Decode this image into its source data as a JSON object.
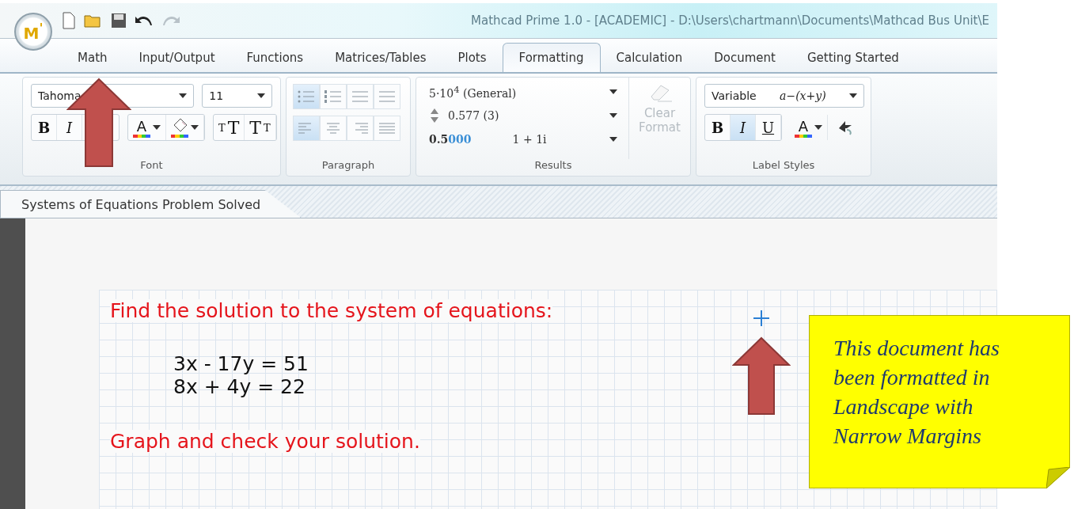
{
  "title_bar": {
    "logo": "M$^{'}$",
    "title": "Mathcad Prime 1.0 - [ACADEMIC] - D:\\Users\\chartmann\\Documents\\Mathcad Bus Unit\\E"
  },
  "ribbon_tabs": [
    {
      "label": "Math",
      "selected": false
    },
    {
      "label": "Input/Output",
      "selected": false
    },
    {
      "label": "Functions",
      "selected": false
    },
    {
      "label": "Matrices/Tables",
      "selected": false
    },
    {
      "label": "Plots",
      "selected": false
    },
    {
      "label": "Formatting",
      "selected": true
    },
    {
      "label": "Calculation",
      "selected": false
    },
    {
      "label": "Document",
      "selected": false
    },
    {
      "label": "Getting Started",
      "selected": false
    }
  ],
  "font_group": {
    "font": "Tahoma",
    "size": "11",
    "bold": "B",
    "italic": "I",
    "font_color": "A",
    "grow_font": "TT",
    "shrink_font": "TT",
    "label": "Font"
  },
  "paragraph_group": {
    "list_buttons": [
      {
        "kind": "bullets",
        "selected": true
      },
      {
        "kind": "numbers",
        "selected": false
      },
      {
        "kind": "indent",
        "selected": false
      },
      {
        "kind": "outdent",
        "selected": false
      }
    ],
    "align_buttons": [
      {
        "kind": "left",
        "selected": true
      },
      {
        "kind": "center",
        "selected": false
      },
      {
        "kind": "right",
        "selected": false
      },
      {
        "kind": "justify",
        "selected": false
      }
    ],
    "label": "Paragraph"
  },
  "results_group": {
    "format": "5·10$^{4}$ (General)",
    "precision": "0.577 (3)",
    "zeros_shown": "0.5",
    "zeros_trailing": "000",
    "complex": "1 + 1i",
    "clear_format": "Clear Format",
    "label": "Results"
  },
  "label_styles": {
    "style": "Variable",
    "sample": "a−(x+y)",
    "buttons": [
      {
        "kind": "bold",
        "label": "B",
        "selected": false
      },
      {
        "kind": "italic",
        "label": "I",
        "selected": true
      },
      {
        "kind": "underline",
        "label": "U",
        "selected": false
      }
    ],
    "font_color": "A",
    "label": "Label Styles"
  },
  "document_tab": {
    "title": "Systems of Equations Problem Solved"
  },
  "worksheet": {
    "heading": "Find the solution to the system of equations:",
    "equations": [
      "3x - 17y = 51",
      "8x + 4y = 22"
    ],
    "footer": "Graph and check your solution."
  },
  "note": {
    "text": "This document has been formatted in Landscape with Narrow Margins"
  }
}
